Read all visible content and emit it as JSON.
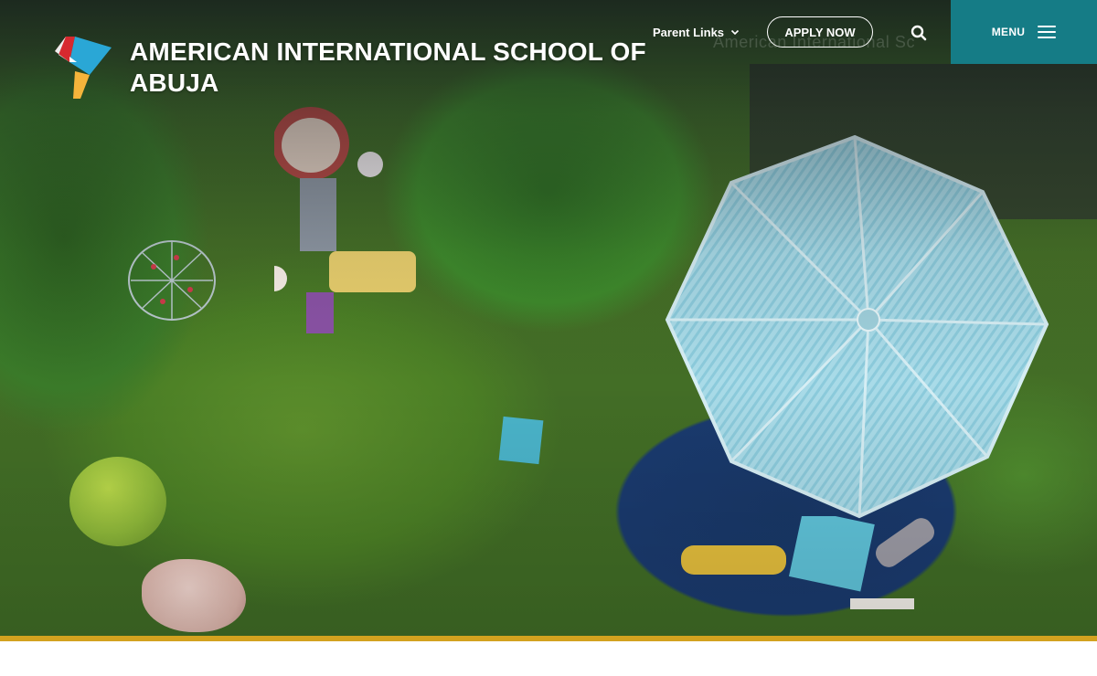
{
  "header": {
    "school_name": "AMERICAN INTERNATIONAL SCHOOL OF ABUJA",
    "parent_links_label": "Parent Links",
    "apply_label": "APPLY NOW",
    "menu_label": "MENU",
    "watermark_text": "American International Sc"
  },
  "icons": {
    "logo": "kite-logo",
    "parent_links_caret": "chevron-down-icon",
    "search": "search-icon",
    "menu": "hamburger-icon"
  },
  "colors": {
    "menu_background": "#157c86",
    "accent_bar": "#d3a21f",
    "text": "#ffffff"
  }
}
